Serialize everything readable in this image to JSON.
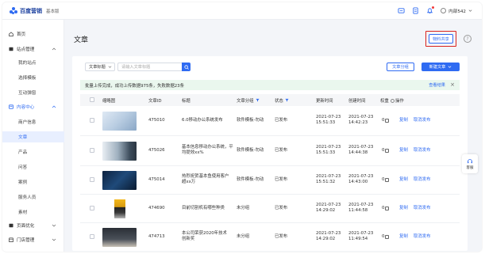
{
  "brand": {
    "name": "百度营销",
    "edition": "基本版"
  },
  "topbar": {
    "user": "内部542",
    "icons": [
      "message-icon",
      "document-icon",
      "bell-icon",
      "user-icon"
    ]
  },
  "sidebar": {
    "items": [
      {
        "label": "首页",
        "icon": "home-icon",
        "type": "top"
      },
      {
        "label": "站点管理",
        "icon": "site-icon",
        "type": "group",
        "expanded": true
      },
      {
        "label": "我的站点",
        "type": "sub"
      },
      {
        "label": "选择模板",
        "type": "sub"
      },
      {
        "label": "互动弹窗",
        "type": "sub"
      },
      {
        "label": "内容中心",
        "icon": "content-icon",
        "type": "group",
        "expanded": true,
        "active_group": true
      },
      {
        "label": "商户信息",
        "type": "sub"
      },
      {
        "label": "文章",
        "type": "sub",
        "selected": true
      },
      {
        "label": "产品",
        "type": "sub"
      },
      {
        "label": "问答",
        "type": "sub"
      },
      {
        "label": "案例",
        "type": "sub"
      },
      {
        "label": "服务人员",
        "type": "sub"
      },
      {
        "label": "素材",
        "type": "sub"
      },
      {
        "label": "页面优化",
        "icon": "page-icon",
        "type": "group",
        "expanded": false
      },
      {
        "label": "门店管理",
        "icon": "store-icon",
        "type": "group",
        "expanded": false
      }
    ]
  },
  "main": {
    "title": "文章",
    "share_button": "物料共享",
    "filter": {
      "select": "文章标题",
      "placeholder": "请输入文章标题"
    },
    "category_button": "文章分组",
    "new_button": "新建文章",
    "notice": {
      "text": "批量上传完成，成功上传数据975条，失败数据23条",
      "link": "查看结果",
      "close": "×"
    },
    "columns": {
      "thumb": "缩略图",
      "id": "文章ID",
      "title": "标题",
      "category": "文章分组",
      "status": "状态",
      "updated": "更新时间",
      "created": "创建时间",
      "weight": "权重",
      "ops": "操作"
    },
    "rows": [
      {
        "id": "475010",
        "title": [
          "6.0移动办公系统发布",
          ""
        ],
        "category": "软件模板-勿动",
        "status": "已发布",
        "updated": [
          "2021-07-23",
          "15:51:33"
        ],
        "created": [
          "2021-07-23",
          "14:42:23"
        ],
        "weight": "0",
        "op1": "复制",
        "op2": "取消发布"
      },
      {
        "id": "475026",
        "title": [
          "基本信息移动办公系统，平",
          "均提效xx%"
        ],
        "category": "软件模板-勿动",
        "status": "已发布",
        "updated": [
          "2021-07-23",
          "15:51:33"
        ],
        "created": [
          "2021-07-23",
          "14:44:38"
        ],
        "weight": "0",
        "op1": "复制",
        "op2": "取消发布"
      },
      {
        "id": "475014",
        "title": [
          "热烈祝贺基本鱼使用客户",
          "超xx万"
        ],
        "category": "软件模板-勿动",
        "status": "已发布",
        "updated": [
          "2021-07-23",
          "15:51:32"
        ],
        "created": [
          "2021-07-23",
          "14:43:00"
        ],
        "weight": "0",
        "op1": "复制",
        "op2": "取消发布"
      },
      {
        "id": "474690",
        "title": [
          "目前切割机有哪些种类",
          ""
        ],
        "category": "未分组",
        "status": "已发布",
        "updated": [
          "2021-07-23",
          "14:29:02"
        ],
        "created": [
          "2021-07-23",
          "11:44:58"
        ],
        "weight": "0",
        "op1": "复制",
        "op2": "取消发布"
      },
      {
        "id": "474713",
        "title": [
          "本公司荣获2020年技术",
          "创新奖"
        ],
        "category": "未分组",
        "status": "已发布",
        "updated": [
          "2021-07-23",
          "14:29:02"
        ],
        "created": [
          "2021-07-23",
          "11:49:54"
        ],
        "weight": "0",
        "op1": "复制",
        "op2": "取消发布"
      }
    ]
  },
  "float_widget": {
    "label": "客服",
    "icon": "customer-service-icon"
  }
}
